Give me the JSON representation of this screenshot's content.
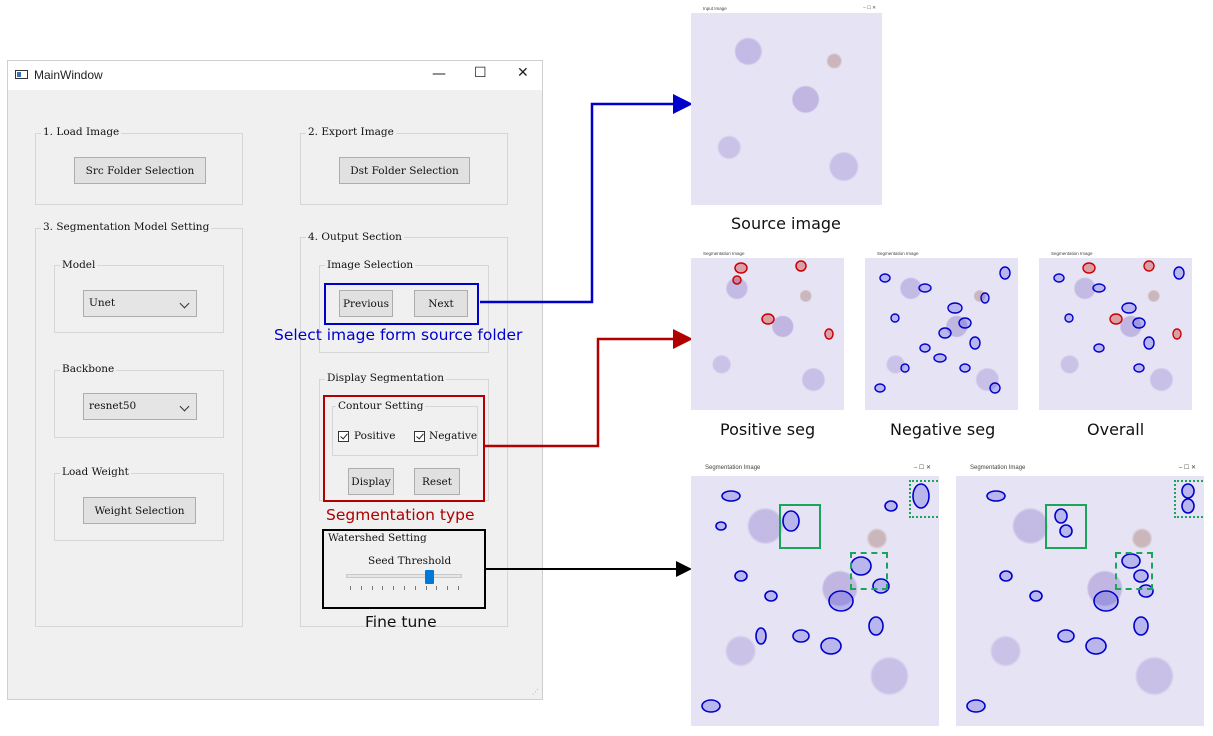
{
  "main_window": {
    "title": "MainWindow",
    "minimize": "—",
    "maximize": "☐",
    "close": "✕",
    "load_image": {
      "label": "1. Load Image",
      "button": "Src Folder Selection"
    },
    "export_image": {
      "label": "2. Export Image",
      "button": "Dst Folder Selection"
    },
    "seg_model": {
      "label": "3. Segmentation Model Setting",
      "model": {
        "label": "Model",
        "value": "Unet"
      },
      "backbone": {
        "label": "Backbone",
        "value": "resnet50"
      },
      "load_weight": {
        "label": "Load Weight",
        "button": "Weight Selection"
      }
    },
    "output": {
      "label": "4. Output Section",
      "image_selection": {
        "label": "Image Selection",
        "previous": "Previous",
        "next": "Next"
      },
      "display_seg": {
        "label": "Display Segmentation",
        "contour": {
          "label": "Contour Setting",
          "positive": "Positive",
          "negative": "Negative"
        },
        "display": "Display",
        "reset": "Reset"
      },
      "watershed": {
        "label": "Watershed Setting",
        "slider_label": "Seed Threshold",
        "slider_value": 0.72
      }
    }
  },
  "annotations": {
    "select_image": "Select image form source folder",
    "seg_type": "Segmentation type",
    "fine_tune": "Fine tune"
  },
  "images": {
    "input_title": "Input Image",
    "seg_title": "Segmentation Image",
    "captions": {
      "source": "Source image",
      "positive": "Positive seg",
      "negative": "Negative seg",
      "overall": "Overall"
    }
  },
  "colors": {
    "blue": "#0000cc",
    "red": "#b00000",
    "black": "#000000",
    "green": "#1aa55a",
    "slider": "#0078d7"
  }
}
